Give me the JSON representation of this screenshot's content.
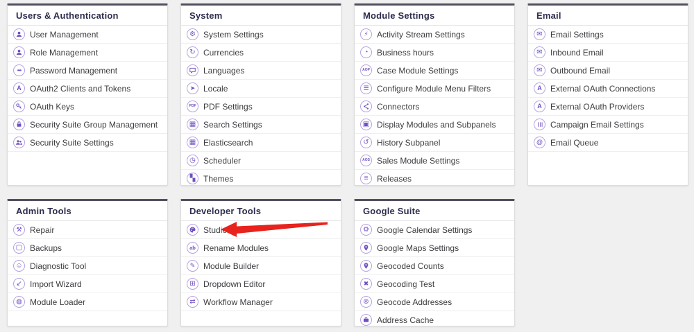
{
  "colors": {
    "page_background": "#f0f0f0",
    "card_top_border": "#50505f",
    "icon_purple": "#6f4fc3",
    "icon_ring_purple": "#b6a3e2",
    "annotation_arrow_red": "#e8221c"
  },
  "panels": [
    {
      "title": "Users & Authentication",
      "items": [
        {
          "label": "User Management",
          "icon": "user-icon"
        },
        {
          "label": "Role Management",
          "icon": "role-icon"
        },
        {
          "label": "Password Management",
          "icon": "password-dots-icon"
        },
        {
          "label": "OAuth2 Clients and Tokens",
          "icon": "oauth-letter-icon"
        },
        {
          "label": "OAuth Keys",
          "icon": "key-icon"
        },
        {
          "label": "Security Suite Group Management",
          "icon": "lock-icon"
        },
        {
          "label": "Security Suite Settings",
          "icon": "user-group-icon"
        }
      ]
    },
    {
      "title": "System",
      "items": [
        {
          "label": "System Settings",
          "icon": "gear-icon"
        },
        {
          "label": "Currencies",
          "icon": "currency-refresh-icon"
        },
        {
          "label": "Languages",
          "icon": "speech-bubble-icon"
        },
        {
          "label": "Locale",
          "icon": "navigation-arrow-icon"
        },
        {
          "label": "PDF Settings",
          "icon": "pdf-icon"
        },
        {
          "label": "Search Settings",
          "icon": "search-grid-icon"
        },
        {
          "label": "Elasticsearch",
          "icon": "elasticsearch-icon"
        },
        {
          "label": "Scheduler",
          "icon": "scheduler-clock-icon"
        },
        {
          "label": "Themes",
          "icon": "themes-icon"
        }
      ]
    },
    {
      "title": "Module Settings",
      "items": [
        {
          "label": "Activity Stream Settings",
          "icon": "lightning-icon"
        },
        {
          "label": "Business hours",
          "icon": "clock-icon"
        },
        {
          "label": "Case Module Settings",
          "icon": "aop-badge-icon"
        },
        {
          "label": "Configure Module Menu Filters",
          "icon": "sliders-icon"
        },
        {
          "label": "Connectors",
          "icon": "share-nodes-icon"
        },
        {
          "label": "Display Modules and Subpanels",
          "icon": "monitor-icon"
        },
        {
          "label": "History Subpanel",
          "icon": "history-icon"
        },
        {
          "label": "Sales Module Settings",
          "icon": "aos-badge-icon"
        },
        {
          "label": "Releases",
          "icon": "layers-icon"
        }
      ]
    },
    {
      "title": "Email",
      "items": [
        {
          "label": "Email Settings",
          "icon": "envelope-icon"
        },
        {
          "label": "Inbound Email",
          "icon": "envelope-inbound-icon"
        },
        {
          "label": "Outbound Email",
          "icon": "envelope-outbound-icon"
        },
        {
          "label": "External OAuth Connections",
          "icon": "oauth-letter-icon"
        },
        {
          "label": "External OAuth Providers",
          "icon": "oauth-letter-icon"
        },
        {
          "label": "Campaign Email Settings",
          "icon": "vertical-sliders-icon"
        },
        {
          "label": "Email Queue",
          "icon": "email-queue-icon"
        }
      ]
    },
    {
      "title": "Admin Tools",
      "items": [
        {
          "label": "Repair",
          "icon": "wrench-icon"
        },
        {
          "label": "Backups",
          "icon": "box-icon"
        },
        {
          "label": "Diagnostic Tool",
          "icon": "diagnostic-icon"
        },
        {
          "label": "Import Wizard",
          "icon": "import-arrow-icon"
        },
        {
          "label": "Module Loader",
          "icon": "loader-ring-icon"
        }
      ]
    },
    {
      "title": "Developer Tools",
      "items": [
        {
          "label": "Studio",
          "icon": "palette-icon"
        },
        {
          "label": "Rename Modules",
          "icon": "ab-badge-icon"
        },
        {
          "label": "Module Builder",
          "icon": "builder-pencil-icon"
        },
        {
          "label": "Dropdown Editor",
          "icon": "dropdown-grid-icon"
        },
        {
          "label": "Workflow Manager",
          "icon": "workflow-arrows-icon"
        }
      ]
    },
    {
      "title": "Google Suite",
      "items": [
        {
          "label": "Google Calendar Settings",
          "icon": "gear-icon"
        },
        {
          "label": "Google Maps Settings",
          "icon": "map-pin-icon"
        },
        {
          "label": "Geocoded Counts",
          "icon": "map-pin-icon"
        },
        {
          "label": "Geocoding Test",
          "icon": "crossed-arrows-icon"
        },
        {
          "label": "Geocode Addresses",
          "icon": "target-ring-icon"
        },
        {
          "label": "Address Cache",
          "icon": "briefcase-icon"
        }
      ]
    }
  ],
  "annotation": {
    "type": "red-arrow",
    "points_at_label": "Studio",
    "color": "#e8221c"
  }
}
